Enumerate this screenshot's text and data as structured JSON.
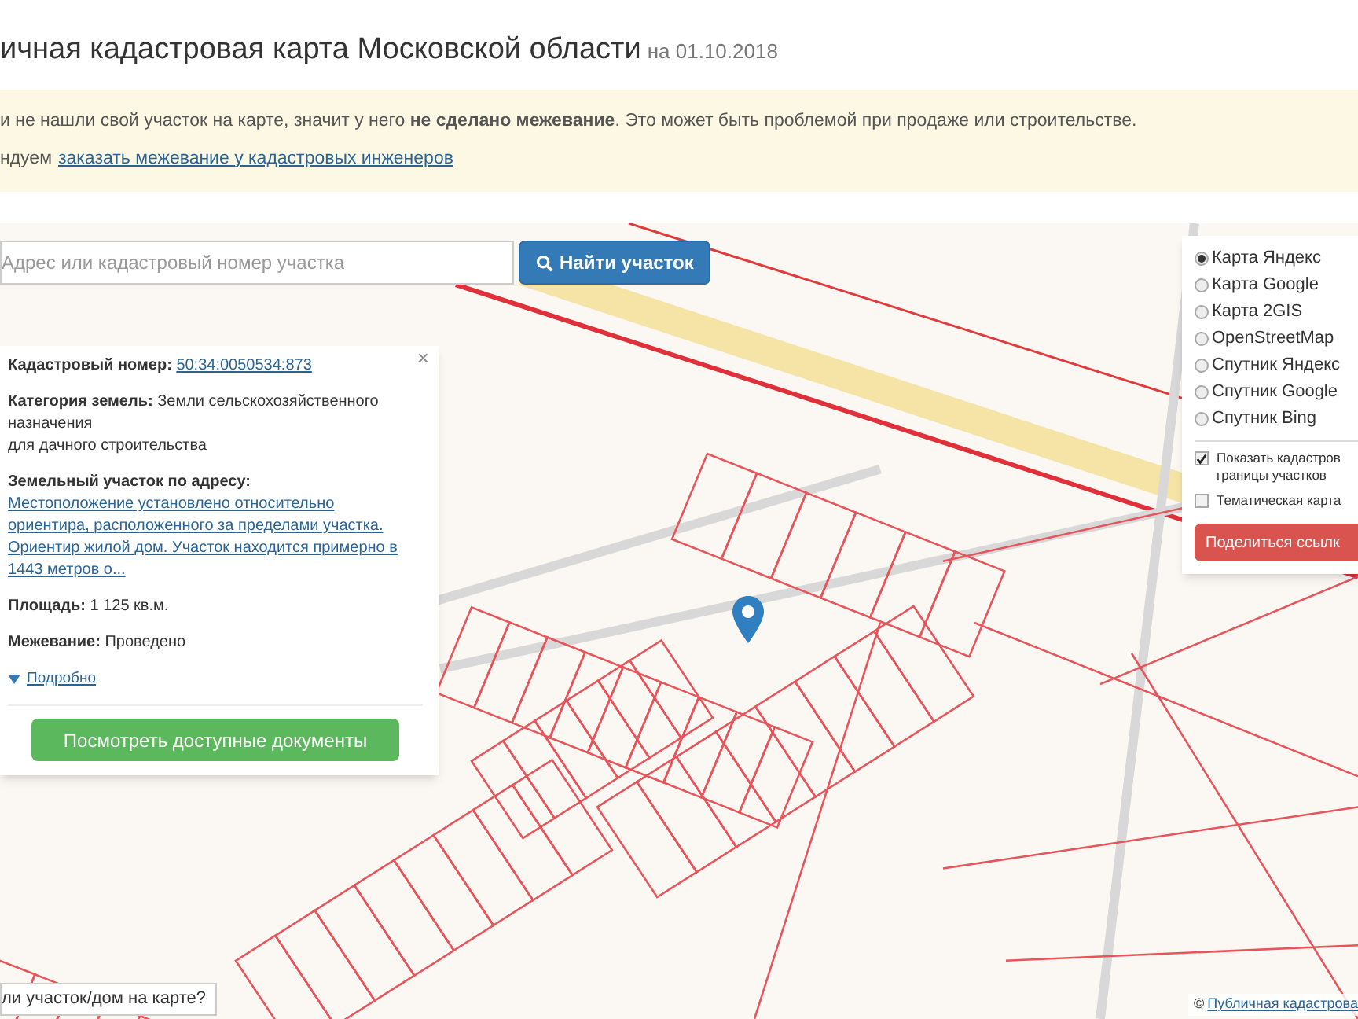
{
  "header": {
    "title": "ичная кадастровая карта Московской области",
    "date": "на 01.10.2018"
  },
  "notice": {
    "text": "и не нашли свой участок на карте, значит у него **не сделано межевание**. Это может быть проблемой при продаже или строительстве.",
    "prefix": "ндуем",
    "link": "заказать межевание у кадастровых инженеров"
  },
  "search": {
    "placeholder": "Адрес или кадастровый номер участка",
    "button": "Найти участок"
  },
  "info_popup": {
    "close": "×",
    "fields": [
      {
        "label": "Кадастровый номер:",
        "value": "50:34:0050534:873",
        "kind": "link"
      },
      {
        "label": "Категория земель:",
        "value": "Земли сельскохозяйственного назначения\nдля дачного строительства",
        "kind": "text"
      },
      {
        "label": "Земельный участок по адресу:",
        "value": "Местоположение установлено относительно ориентира, расположенного за пределами участка. Ориентир жилой дом. Участок находится примерно в 1443 метров о...",
        "kind": "link"
      },
      {
        "label": "Площадь:",
        "value": "1 125 кв.м.",
        "kind": "text"
      },
      {
        "label": "Межевание:",
        "value": "Проведено",
        "kind": "text"
      }
    ],
    "details_link": "Подробно",
    "documents_button": "Посмотреть доступные документы"
  },
  "layers": {
    "base_maps": [
      {
        "label": "Карта Яндекс",
        "selected": true
      },
      {
        "label": "Карта Google",
        "selected": false
      },
      {
        "label": "Карта 2GIS",
        "selected": false
      },
      {
        "label": "OpenStreetMap",
        "selected": false
      },
      {
        "label": "Спутник Яндекс",
        "selected": false
      },
      {
        "label": "Спутник Google",
        "selected": false
      },
      {
        "label": "Спутник Bing",
        "selected": false
      }
    ],
    "overlays": [
      {
        "label": "Показать кадастров\nграницы участков",
        "checked": true
      },
      {
        "label": "Тематическая карта",
        "checked": false
      }
    ],
    "share_button": "Поделиться ссылк"
  },
  "footer": {
    "help": "ли участок/дом на карте?",
    "copyright": "©",
    "attribution": "Публичная кадастрова"
  }
}
